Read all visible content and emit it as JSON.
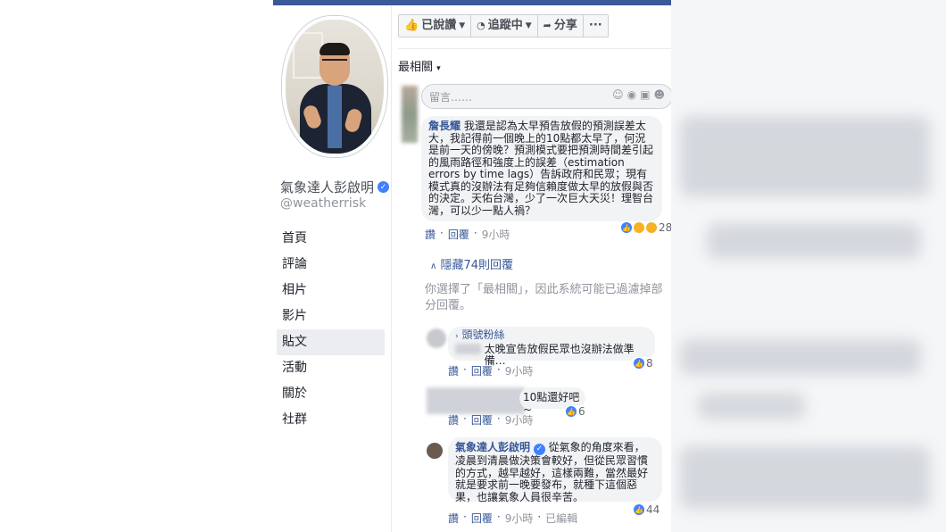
{
  "page": {
    "name": "氣象達人彭啟明",
    "handle": "@weatherrisk",
    "nav": [
      "首頁",
      "評論",
      "相片",
      "影片",
      "貼文",
      "活動",
      "關於",
      "社群"
    ],
    "active_nav": "貼文"
  },
  "actions": {
    "liked": "已說讚",
    "following": "追蹤中",
    "share": "分享",
    "more": "···"
  },
  "sort": "最相關",
  "sort_arrow": "▾",
  "composer": {
    "placeholder": "留言……",
    "icons": [
      "smile-icon",
      "camera-icon",
      "gif-icon",
      "sticker-icon"
    ]
  },
  "comments": [
    {
      "author": "詹長耀",
      "text": "我還是認為太早預告放假的預測誤差太大，我記得前一個晚上的10點都太早了，何況是前一天的傍晚？預測模式要把預測時間差引起的風雨路徑和強度上的誤差（estimation errors by time lags）告訴政府和民眾；現有模式真的沒辦法有足夠信賴度做太早的放假與否的決定。天佑台灣，少了一次巨大天災！理智台灣，可以少一點人禍？",
      "like": "讚",
      "reply": "回覆",
      "time": "9小時",
      "reactions": "28"
    }
  ],
  "hidden_replies": "隱藏74則回覆",
  "filter_note": "你選擇了「最相關」，因此系統可能已過濾掉部分回覆。",
  "replies": [
    {
      "badge": "頭號粉絲",
      "text": "太晚宣告放假民眾也沒辦法做準備…",
      "like": "讚",
      "reply": "回覆",
      "time": "9小時",
      "reactions": "8"
    },
    {
      "text": "10點還好吧~",
      "like": "讚",
      "reply": "回覆",
      "time": "9小時",
      "reactions": "6"
    },
    {
      "author": "氣象達人彭啟明",
      "text": "從氣象的角度來看，凌晨到清晨做決策會較好，但從民眾習慣的方式，越早越好，這樣兩難，當然最好就是要求前一晚要發布，就種下這個惡果，也讓氣象人員很辛苦。",
      "like": "讚",
      "reply": "回覆",
      "time": "9小時",
      "edited": "已編輯",
      "reactions": "44"
    }
  ],
  "colors": {
    "facebook_blue": "#3b5998",
    "link": "#385898",
    "like_blue": "#4080ff"
  }
}
